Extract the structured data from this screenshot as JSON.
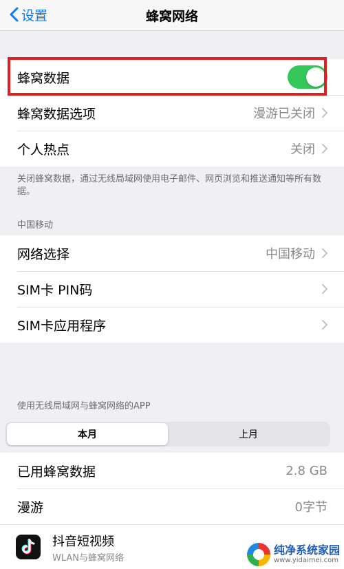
{
  "navbar": {
    "back_label": "设置",
    "title": "蜂窝网络"
  },
  "cellular_group": {
    "cellular_data": {
      "label": "蜂窝数据",
      "enabled": true
    },
    "options": {
      "label": "蜂窝数据选项",
      "value": "漫游已关闭"
    },
    "hotspot": {
      "label": "个人热点",
      "value": "关闭"
    }
  },
  "footer_note": "关闭蜂窝数据，通过无线局域网使用电子邮件、网页浏览和推送通知等所有数据。",
  "carrier_header": "中国移动",
  "carrier_group": {
    "network_select": {
      "label": "网络选择",
      "value": "中国移动"
    },
    "sim_pin": {
      "label": "SIM卡 PIN码"
    },
    "sim_apps": {
      "label": "SIM卡应用程序"
    }
  },
  "apps_header": "使用无线局域网与蜂窝网络的APP",
  "segment": {
    "current": "本月",
    "last": "上月",
    "selected": "current"
  },
  "usage_group": {
    "used": {
      "label": "已用蜂窝数据",
      "value": "2.8 GB"
    },
    "roaming": {
      "label": "漫游",
      "value": "0字节"
    }
  },
  "app_item": {
    "name": "抖音短视频",
    "subtitle": "WLAN与蜂窝网络"
  },
  "watermark": {
    "title": "纯净系统家园",
    "url": "www.yidaimei.com"
  },
  "colors": {
    "accent": "#0a7aff",
    "toggle_on": "#34c759",
    "highlight": "#e02020"
  }
}
